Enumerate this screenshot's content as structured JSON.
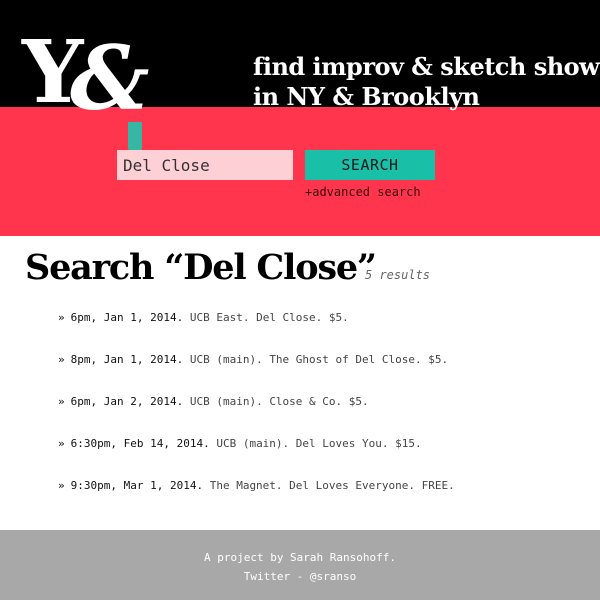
{
  "header": {
    "logo": {
      "letter": "Y",
      "ampersand": "&"
    },
    "tagline_line1": "find improv & sketch shows",
    "tagline_line2": "in NY & Brooklyn"
  },
  "search": {
    "value": "Del Close",
    "button_label": "SEARCH",
    "advanced_label": "+advanced search"
  },
  "results": {
    "heading": "Search “Del Close”",
    "count_label": "5 results",
    "bullet": "»",
    "items": [
      {
        "datetime": "6pm, Jan 1, 2014.",
        "details": "UCB East. Del Close. $5."
      },
      {
        "datetime": "8pm, Jan 1, 2014.",
        "details": "UCB (main). The Ghost of Del Close. $5."
      },
      {
        "datetime": "6pm, Jan 2, 2014.",
        "details": "UCB (main). Close & Co. $5."
      },
      {
        "datetime": "6:30pm, Feb 14, 2014.",
        "details": "UCB (main). Del Loves You. $15."
      },
      {
        "datetime": "9:30pm, Mar 1, 2014.",
        "details": "The Magnet. Del Loves Everyone. FREE."
      }
    ]
  },
  "footer": {
    "credit": "A project by Sarah Ransohoff.",
    "twitter_label": "Twitter - @sranso"
  },
  "colors": {
    "header_black": "#000000",
    "accent_red": "#fe354c",
    "search_input_bg": "#fdd0d6",
    "search_button_teal": "#19bfa6",
    "footer_gray": "#a8a8a8"
  }
}
